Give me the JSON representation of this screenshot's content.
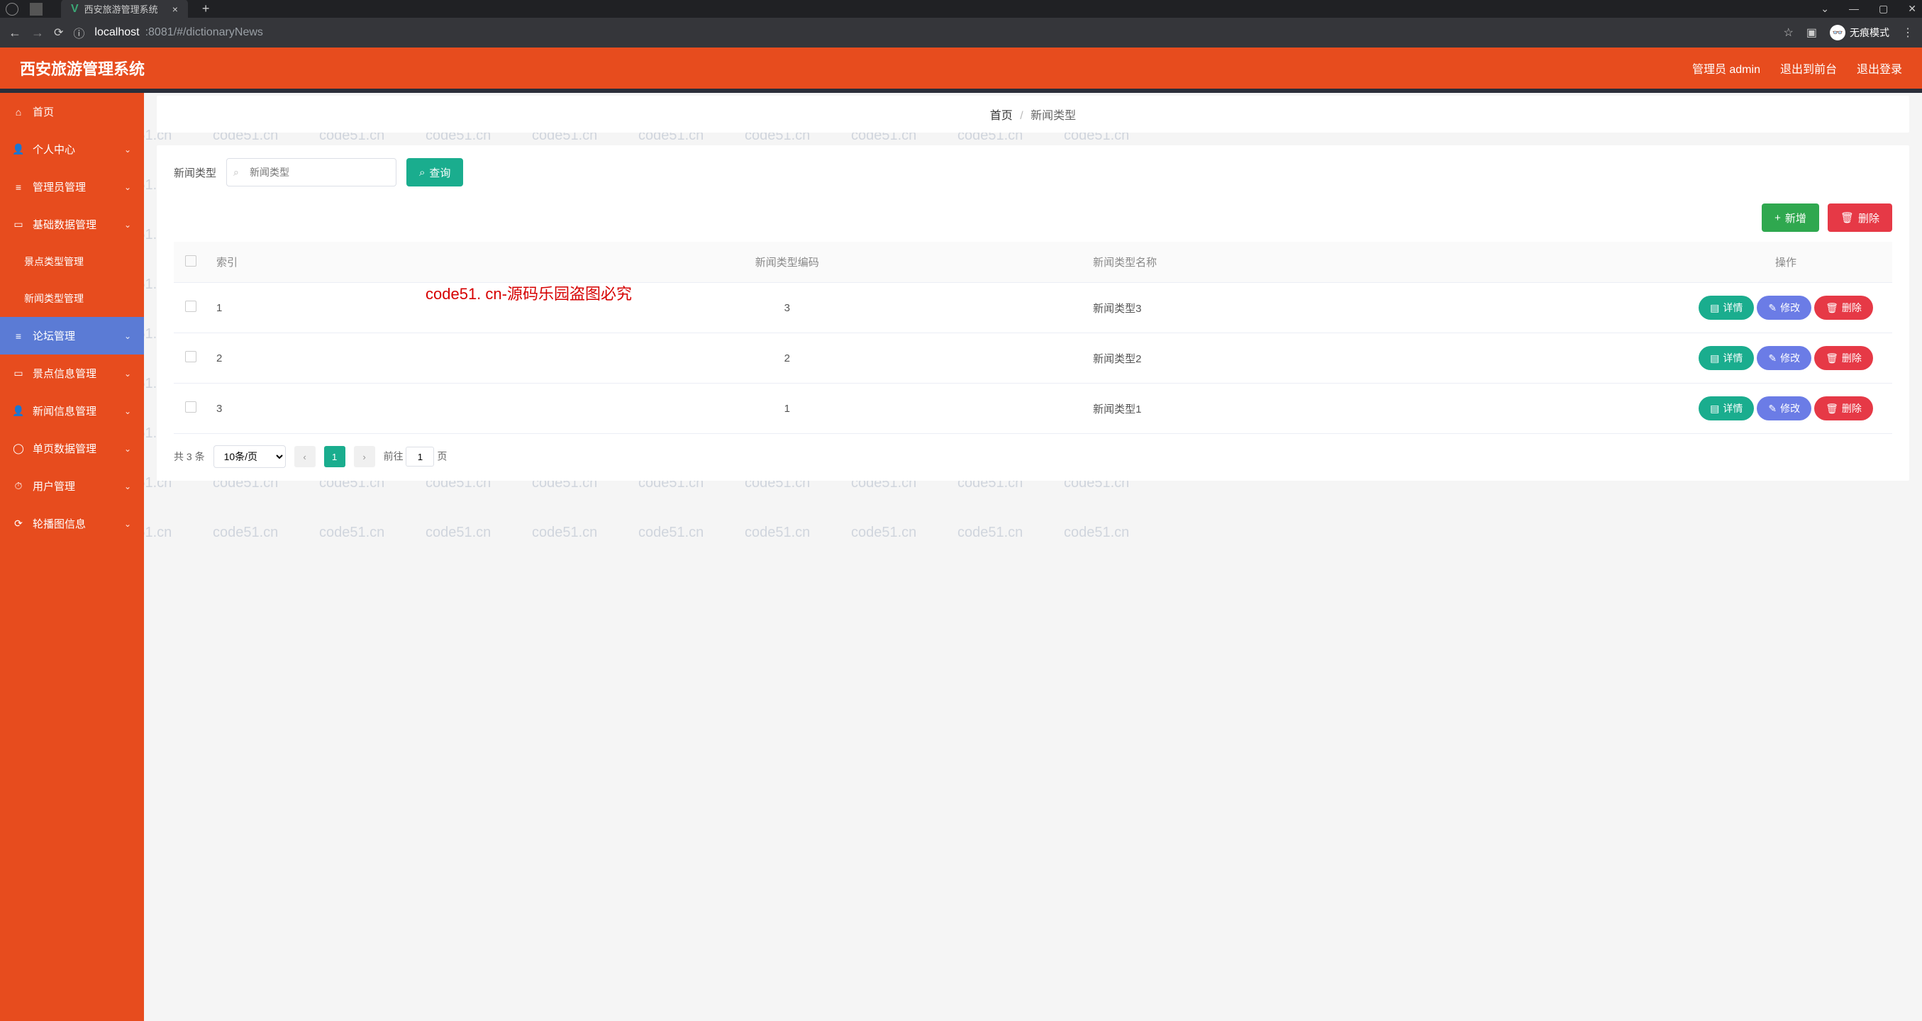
{
  "browser": {
    "tab_title": "西安旅游管理系统",
    "url_host": "localhost",
    "url_port_path": ":8081/#/dictionaryNews",
    "incognito_label": "无痕模式"
  },
  "header": {
    "app_title": "西安旅游管理系统",
    "user_label": "管理员 admin",
    "logout_front": "退出到前台",
    "logout": "退出登录"
  },
  "sidebar": {
    "items": [
      {
        "label": "首页",
        "icon": "⌂"
      },
      {
        "label": "个人中心",
        "icon": "👤",
        "expandable": true
      },
      {
        "label": "管理员管理",
        "icon": "≡",
        "expandable": true
      },
      {
        "label": "基础数据管理",
        "icon": "▭",
        "expandable": true,
        "expanded": true,
        "children": [
          {
            "label": "景点类型管理"
          },
          {
            "label": "新闻类型管理"
          }
        ]
      },
      {
        "label": "论坛管理",
        "icon": "≡",
        "expandable": true,
        "active": true
      },
      {
        "label": "景点信息管理",
        "icon": "▭",
        "expandable": true
      },
      {
        "label": "新闻信息管理",
        "icon": "👤",
        "expandable": true
      },
      {
        "label": "单页数据管理",
        "icon": "◯",
        "expandable": true
      },
      {
        "label": "用户管理",
        "icon": "⏱",
        "expandable": true
      },
      {
        "label": "轮播图信息",
        "icon": "⟳",
        "expandable": true
      }
    ]
  },
  "breadcrumb": {
    "root": "首页",
    "current": "新闻类型"
  },
  "search": {
    "label": "新闻类型",
    "placeholder": "新闻类型",
    "query_btn": "查询"
  },
  "toolbar": {
    "add_btn": "新增",
    "delete_btn": "删除"
  },
  "table": {
    "headers": {
      "index": "索引",
      "code": "新闻类型编码",
      "name": "新闻类型名称",
      "ops": "操作"
    },
    "row_btn": {
      "detail": "详情",
      "edit": "修改",
      "delete": "删除"
    },
    "rows": [
      {
        "idx": "1",
        "code": "3",
        "name": "新闻类型3"
      },
      {
        "idx": "2",
        "code": "2",
        "name": "新闻类型2"
      },
      {
        "idx": "3",
        "code": "1",
        "name": "新闻类型1"
      }
    ]
  },
  "pager": {
    "total_prefix": "共",
    "total": "3",
    "total_suffix": "条",
    "size_label": "10条/页",
    "current": "1",
    "goto_prefix": "前往",
    "goto_value": "1",
    "goto_suffix": "页"
  },
  "watermark_text": "code51.cn",
  "overlay_text": "code51. cn-源码乐园盗图必究"
}
